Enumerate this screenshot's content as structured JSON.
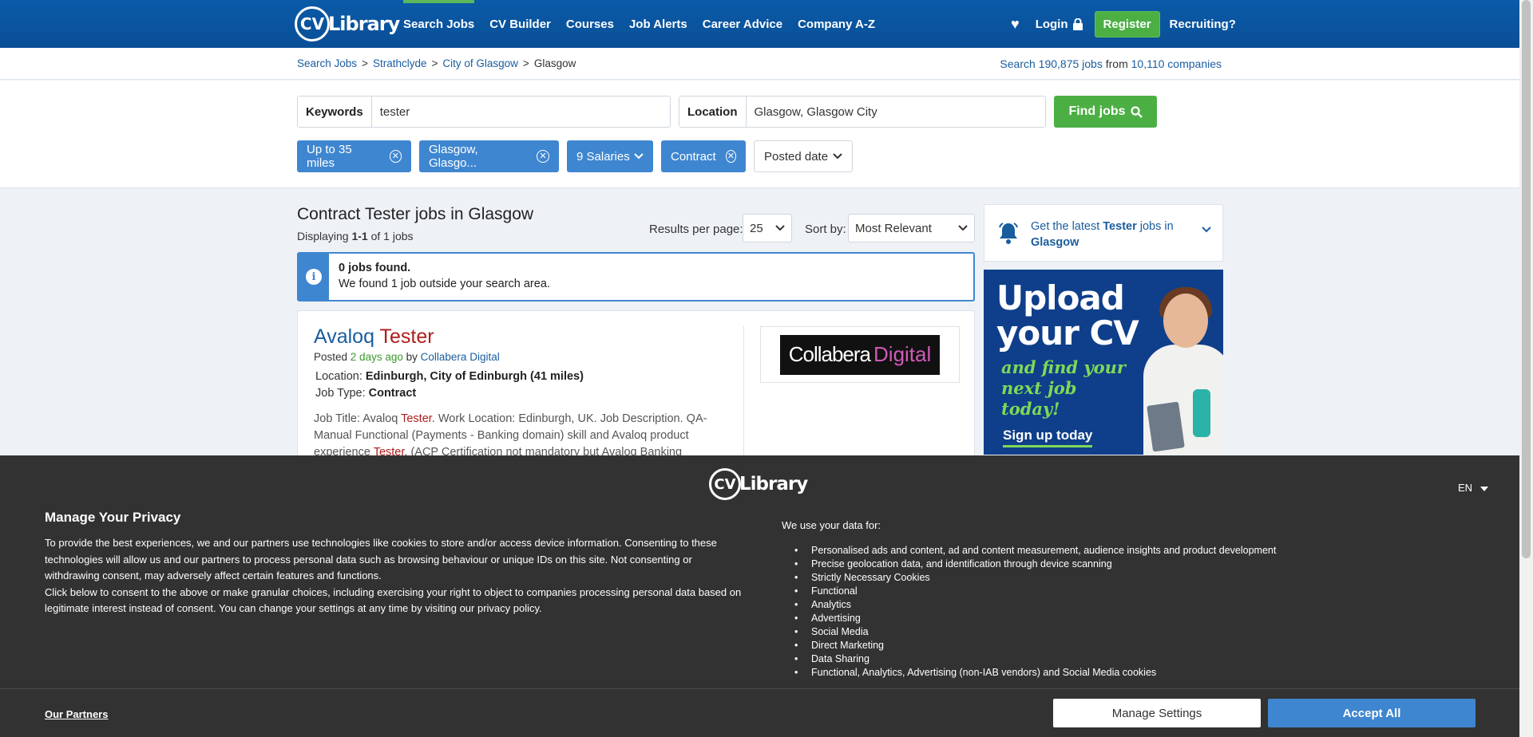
{
  "nav": {
    "logo_cv": "CV",
    "logo_text": "Library",
    "links": [
      "Search Jobs",
      "CV Builder",
      "Courses",
      "Job Alerts",
      "Career Advice",
      "Company A-Z"
    ],
    "login": "Login",
    "register": "Register",
    "recruiting": "Recruiting?"
  },
  "breadcrumb": {
    "items": [
      "Search Jobs",
      "Strathclyde",
      "City of Glasgow"
    ],
    "current": "Glasgow",
    "separator": ">"
  },
  "totals": {
    "prefix": "Search",
    "jobs": "190,875 jobs",
    "from": "from",
    "companies": "10,110 companies"
  },
  "search": {
    "keywords_label": "Keywords",
    "keywords_value": "tester",
    "location_label": "Location",
    "location_value": "Glasgow, Glasgow City",
    "find_label": "Find jobs"
  },
  "filters": {
    "distance": "Up to 35 miles",
    "location": "Glasgow, Glasgo...",
    "salaries": "9 Salaries",
    "type": "Contract",
    "posted": "Posted date"
  },
  "results": {
    "title": "Contract Tester jobs in Glasgow",
    "displaying": "Displaying",
    "range": "1-1",
    "of_total": "of 1 jobs",
    "per_page_label": "Results per page:",
    "per_page_value": "25",
    "sort_label": "Sort by:",
    "sort_value": "Most Relevant"
  },
  "info": {
    "line1": "0 jobs found.",
    "line2": "We found 1 job outside your search area."
  },
  "job": {
    "title_a": "Avaloq ",
    "title_b": "Tester",
    "posted_prefix": "Posted",
    "posted_ago": "2 days ago",
    "posted_by": "by",
    "company": "Collabera Digital",
    "location_label": "Location:",
    "location_value": "Edinburgh, City of Edinburgh (41 miles)",
    "type_label": "Job Type:",
    "type_value": "Contract",
    "desc_1": "Job Title: Avaloq ",
    "desc_hl1": "Tester",
    "desc_2": ". Work Location: Edinburgh, UK. Job Description. QA-Manual Functional (Payments - Banking domain) skill and Avaloq product experience ",
    "desc_hl2": "Tester",
    "desc_3": ". (ACP Certification not mandatory but Avaloq Banking",
    "logo_a": "Collabera",
    "logo_b": "Digital"
  },
  "sidebar": {
    "alert_a": "Get the latest ",
    "alert_b": "Tester",
    "alert_c": " jobs in ",
    "alert_d": "Glasgow",
    "banner_title": "Upload your CV",
    "banner_sub": "and find your next job today!",
    "banner_cta": "Sign up today"
  },
  "consent": {
    "logo_cv": "CV",
    "logo_text": "Library",
    "lang": "EN",
    "title": "Manage Your Privacy",
    "body_1": "To provide the best experiences, we and our partners use technologies like cookies to store and/or access device information. Consenting to these technologies will allow us and our partners to process personal data such as browsing behaviour or unique IDs on this site. Not consenting or withdrawing consent, may adversely affect certain features and functions.",
    "body_2": "Click below to consent to the above or make granular choices, including exercising your right to object to companies processing personal data based on legitimate interest instead of consent. You can change your settings at any time by visiting our privacy policy.",
    "use_heading": "We use your data for:",
    "uses": [
      "Personalised ads and content, ad and content measurement, audience insights and product development",
      "Precise geolocation data, and identification through device scanning",
      "Strictly Necessary Cookies",
      "Functional",
      "Analytics",
      "Advertising",
      "Social Media",
      "Direct Marketing",
      "Data Sharing",
      "Functional, Analytics, Advertising (non-IAB vendors) and Social Media cookies"
    ],
    "partners": "Our Partners",
    "manage": "Manage Settings",
    "accept": "Accept All"
  },
  "colors": {
    "brand_blue": "#0a5aa8",
    "accent_green": "#4caf44",
    "chip_blue": "#3f86d0",
    "consent_bg": "#323232"
  }
}
